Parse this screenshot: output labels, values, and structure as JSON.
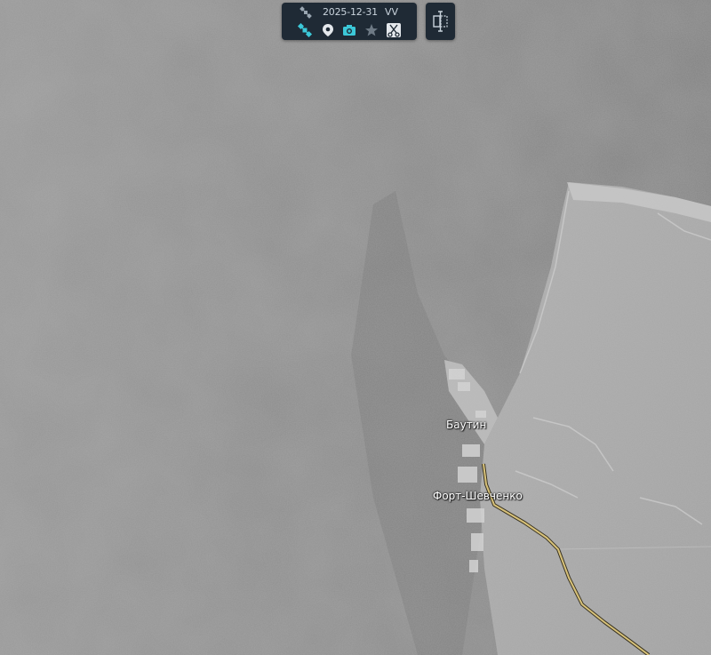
{
  "toolbar": {
    "date": "2025-12-31",
    "mode": "VV",
    "icons": [
      "satellite-icon",
      "satellite-active-icon",
      "location-pin-icon",
      "camera-icon",
      "star-icon",
      "scissors-icon"
    ],
    "active_color": "#3cc8d8",
    "inactive_color": "#7e8a95"
  },
  "side_button": {
    "icon": "compare-split-icon"
  },
  "map": {
    "labels": {
      "bautin": "Баутин",
      "fort_shevchenko": "Форт-Шевченко"
    },
    "road_color": "#d8c27a"
  }
}
